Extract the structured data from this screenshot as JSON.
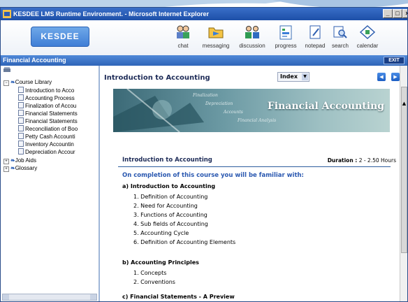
{
  "window": {
    "title": "KESDEE LMS Runtime Environment. - Microsoft Internet Explorer"
  },
  "brand": {
    "logo": "KESDEE"
  },
  "toolbar": [
    {
      "label": "chat",
      "icon": "chat-icon"
    },
    {
      "label": "messaging",
      "icon": "folder-message-icon"
    },
    {
      "label": "discussion",
      "icon": "discussion-icon"
    },
    {
      "label": "progress",
      "icon": "progress-icon"
    },
    {
      "label": "notepad",
      "icon": "notepad-icon"
    },
    {
      "label": "search",
      "icon": "search-icon"
    },
    {
      "label": "calendar",
      "icon": "calendar-icon"
    }
  ],
  "course_bar": {
    "title": "Financial Accounting",
    "exit": "EXIT"
  },
  "tree": {
    "root": "Course Library",
    "children": [
      "Introduction to Acco",
      "Accounting Process",
      "Finalization of Accou",
      "Financial Statements",
      "Financial Statements",
      "Reconciliation of Boo",
      "Petty Cash Accounti",
      "Inventory Accountin",
      "Depreciation Accour"
    ],
    "siblings": [
      "Job Aids",
      "Glossary"
    ]
  },
  "content": {
    "title": "Introduction to Accounting",
    "index_label": "Index",
    "banner": {
      "title": "Financial Accounting",
      "watermarks": [
        "Finalization",
        "Depreciation",
        "Accounts",
        "Financial Analysis"
      ]
    },
    "lesson_title": "Introduction to Accounting",
    "duration_label": "Duration :",
    "duration_value": "2 - 2.50 Hours",
    "objective": "On completion of this course you will be familiar with:",
    "sections": [
      {
        "heading": "a) Introduction to Accounting",
        "items": [
          "1. Definition of Accounting",
          "2. Need for Accounting",
          "3. Functions of Accounting",
          "4. Sub fields of Accounting",
          "5. Accounting Cycle",
          "6. Definition of Accounting Elements"
        ]
      },
      {
        "heading": "b) Accounting Principles",
        "items": [
          "1. Concepts",
          "2. Conventions"
        ]
      },
      {
        "heading": "c) Financial Statements - A Preview",
        "items": []
      }
    ]
  }
}
